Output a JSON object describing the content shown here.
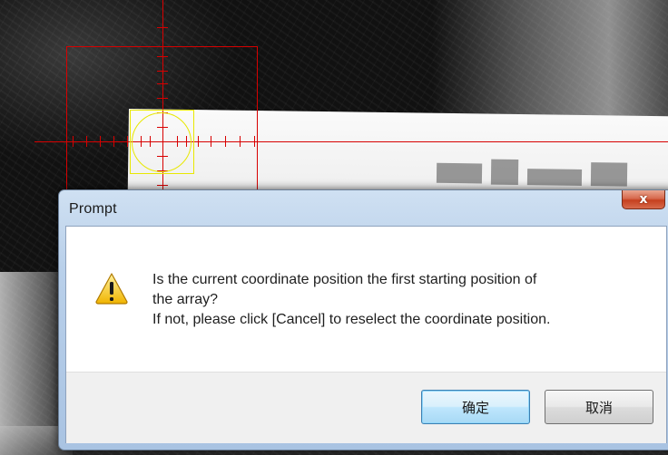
{
  "dialog": {
    "title": "Prompt",
    "close_label": "x",
    "icon": "warning-icon",
    "message_lines": [
      "Is the current coordinate position the first starting position of",
      "the array?",
      "If not, please click [Cancel] to reselect the coordinate position."
    ],
    "ok_label": "确定",
    "cancel_label": "取消"
  },
  "overlay": {
    "crosshair_color": "#d80000",
    "target_color": "#e8e800"
  },
  "theme": {
    "default_button_border": "#3c7fb1",
    "close_button_color": "#c6401e"
  }
}
